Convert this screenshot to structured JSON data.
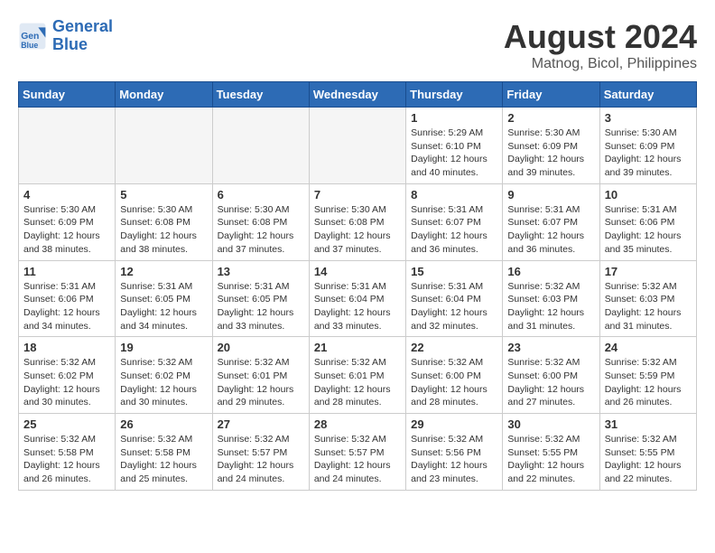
{
  "logo": {
    "line1": "General",
    "line2": "Blue"
  },
  "title": "August 2024",
  "location": "Matnog, Bicol, Philippines",
  "weekdays": [
    "Sunday",
    "Monday",
    "Tuesday",
    "Wednesday",
    "Thursday",
    "Friday",
    "Saturday"
  ],
  "weeks": [
    [
      {
        "day": "",
        "info": ""
      },
      {
        "day": "",
        "info": ""
      },
      {
        "day": "",
        "info": ""
      },
      {
        "day": "",
        "info": ""
      },
      {
        "day": "1",
        "info": "Sunrise: 5:29 AM\nSunset: 6:10 PM\nDaylight: 12 hours\nand 40 minutes."
      },
      {
        "day": "2",
        "info": "Sunrise: 5:30 AM\nSunset: 6:09 PM\nDaylight: 12 hours\nand 39 minutes."
      },
      {
        "day": "3",
        "info": "Sunrise: 5:30 AM\nSunset: 6:09 PM\nDaylight: 12 hours\nand 39 minutes."
      }
    ],
    [
      {
        "day": "4",
        "info": "Sunrise: 5:30 AM\nSunset: 6:09 PM\nDaylight: 12 hours\nand 38 minutes."
      },
      {
        "day": "5",
        "info": "Sunrise: 5:30 AM\nSunset: 6:08 PM\nDaylight: 12 hours\nand 38 minutes."
      },
      {
        "day": "6",
        "info": "Sunrise: 5:30 AM\nSunset: 6:08 PM\nDaylight: 12 hours\nand 37 minutes."
      },
      {
        "day": "7",
        "info": "Sunrise: 5:30 AM\nSunset: 6:08 PM\nDaylight: 12 hours\nand 37 minutes."
      },
      {
        "day": "8",
        "info": "Sunrise: 5:31 AM\nSunset: 6:07 PM\nDaylight: 12 hours\nand 36 minutes."
      },
      {
        "day": "9",
        "info": "Sunrise: 5:31 AM\nSunset: 6:07 PM\nDaylight: 12 hours\nand 36 minutes."
      },
      {
        "day": "10",
        "info": "Sunrise: 5:31 AM\nSunset: 6:06 PM\nDaylight: 12 hours\nand 35 minutes."
      }
    ],
    [
      {
        "day": "11",
        "info": "Sunrise: 5:31 AM\nSunset: 6:06 PM\nDaylight: 12 hours\nand 34 minutes."
      },
      {
        "day": "12",
        "info": "Sunrise: 5:31 AM\nSunset: 6:05 PM\nDaylight: 12 hours\nand 34 minutes."
      },
      {
        "day": "13",
        "info": "Sunrise: 5:31 AM\nSunset: 6:05 PM\nDaylight: 12 hours\nand 33 minutes."
      },
      {
        "day": "14",
        "info": "Sunrise: 5:31 AM\nSunset: 6:04 PM\nDaylight: 12 hours\nand 33 minutes."
      },
      {
        "day": "15",
        "info": "Sunrise: 5:31 AM\nSunset: 6:04 PM\nDaylight: 12 hours\nand 32 minutes."
      },
      {
        "day": "16",
        "info": "Sunrise: 5:32 AM\nSunset: 6:03 PM\nDaylight: 12 hours\nand 31 minutes."
      },
      {
        "day": "17",
        "info": "Sunrise: 5:32 AM\nSunset: 6:03 PM\nDaylight: 12 hours\nand 31 minutes."
      }
    ],
    [
      {
        "day": "18",
        "info": "Sunrise: 5:32 AM\nSunset: 6:02 PM\nDaylight: 12 hours\nand 30 minutes."
      },
      {
        "day": "19",
        "info": "Sunrise: 5:32 AM\nSunset: 6:02 PM\nDaylight: 12 hours\nand 30 minutes."
      },
      {
        "day": "20",
        "info": "Sunrise: 5:32 AM\nSunset: 6:01 PM\nDaylight: 12 hours\nand 29 minutes."
      },
      {
        "day": "21",
        "info": "Sunrise: 5:32 AM\nSunset: 6:01 PM\nDaylight: 12 hours\nand 28 minutes."
      },
      {
        "day": "22",
        "info": "Sunrise: 5:32 AM\nSunset: 6:00 PM\nDaylight: 12 hours\nand 28 minutes."
      },
      {
        "day": "23",
        "info": "Sunrise: 5:32 AM\nSunset: 6:00 PM\nDaylight: 12 hours\nand 27 minutes."
      },
      {
        "day": "24",
        "info": "Sunrise: 5:32 AM\nSunset: 5:59 PM\nDaylight: 12 hours\nand 26 minutes."
      }
    ],
    [
      {
        "day": "25",
        "info": "Sunrise: 5:32 AM\nSunset: 5:58 PM\nDaylight: 12 hours\nand 26 minutes."
      },
      {
        "day": "26",
        "info": "Sunrise: 5:32 AM\nSunset: 5:58 PM\nDaylight: 12 hours\nand 25 minutes."
      },
      {
        "day": "27",
        "info": "Sunrise: 5:32 AM\nSunset: 5:57 PM\nDaylight: 12 hours\nand 24 minutes."
      },
      {
        "day": "28",
        "info": "Sunrise: 5:32 AM\nSunset: 5:57 PM\nDaylight: 12 hours\nand 24 minutes."
      },
      {
        "day": "29",
        "info": "Sunrise: 5:32 AM\nSunset: 5:56 PM\nDaylight: 12 hours\nand 23 minutes."
      },
      {
        "day": "30",
        "info": "Sunrise: 5:32 AM\nSunset: 5:55 PM\nDaylight: 12 hours\nand 22 minutes."
      },
      {
        "day": "31",
        "info": "Sunrise: 5:32 AM\nSunset: 5:55 PM\nDaylight: 12 hours\nand 22 minutes."
      }
    ]
  ]
}
